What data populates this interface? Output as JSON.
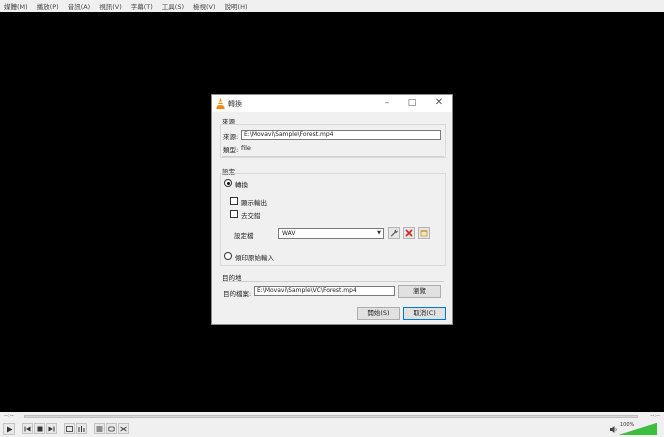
{
  "menubar": {
    "items": [
      "媒體(M)",
      "播放(P)",
      "音訊(A)",
      "視訊(V)",
      "字幕(T)",
      "工具(S)",
      "檢視(V)",
      "說明(H)"
    ]
  },
  "dialog": {
    "title": "轉換",
    "source": {
      "section_title": "來源",
      "source_label": "來源:",
      "source_value": "E:\\Movavi\\Sample\\Forest.mp4",
      "type_label": "類型:",
      "type_value": "file"
    },
    "settings": {
      "section_title": "設定",
      "convert_label": "轉換",
      "show_output_label": "顯示輸出",
      "deinterlace_label": "去交錯",
      "profile_label": "設定檔",
      "profile_value": "WAV",
      "dump_raw_label": "傾印原始輸入"
    },
    "destination": {
      "section_title": "目的地",
      "file_label": "目的檔案:",
      "file_value": "E:\\Movavi\\Sample\\VC\\Forest.mp4",
      "browse_label": "瀏覽"
    },
    "start_label": "開始(S)",
    "cancel_label": "取消(C)"
  },
  "player": {
    "time_elapsed": "--:--",
    "time_total": "--:--",
    "volume": "100%",
    "volume_level": 1.0
  },
  "colors": {
    "vlc_orange": "#f08a00",
    "delete_red": "#d9251c",
    "volume_green": "#3cbf3c"
  }
}
